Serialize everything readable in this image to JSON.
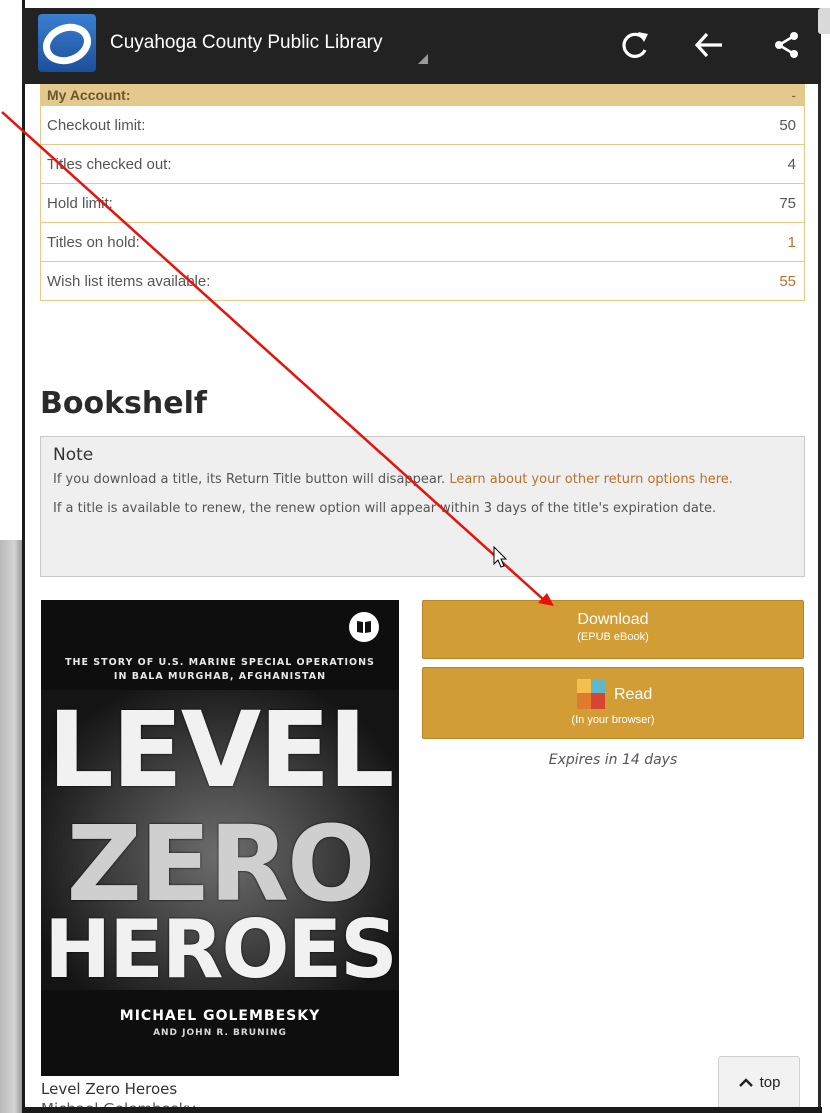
{
  "app": {
    "title": "Cuyahoga County Public Library"
  },
  "account": {
    "header": "My Account:",
    "header_value": "-",
    "rows": [
      {
        "label": "Checkout limit:",
        "value": "50",
        "link": false
      },
      {
        "label": "Titles checked out:",
        "value": "4",
        "link": false
      },
      {
        "label": "Hold limit:",
        "value": "75",
        "link": false
      },
      {
        "label": "Titles on hold:",
        "value": "1",
        "link": true
      },
      {
        "label": "Wish list items available:",
        "value": "55",
        "link": true
      }
    ]
  },
  "bookshelf": {
    "heading": "Bookshelf",
    "note": {
      "title": "Note",
      "text1": "If you download a title, its Return Title button will disappear.",
      "link": "Learn about your other return options here.",
      "text2": "If a title is available to renew, the renew option will appear within 3 days of the title's expiration date."
    },
    "book": {
      "title": "Level Zero Heroes",
      "author_partial": "Michael Golembesky",
      "cover": {
        "subtitle_line1": "THE STORY OF U.S. MARINE SPECIAL OPERATIONS",
        "subtitle_line2": "IN BALA MURGHAB, AFGHANISTAN",
        "word1": "LEVEL",
        "word2": "ZERO",
        "word3": "HEROES",
        "author": "MICHAEL GOLEMBESKY",
        "coauthor": "AND JOHN R. BRUNING"
      }
    },
    "download_button": {
      "label": "Download",
      "sub": "(EPUB eBook)"
    },
    "read_button": {
      "label": "Read",
      "sub": "(In your browser)"
    },
    "expires": "Expires in 14 days"
  },
  "top_button": {
    "label": "top"
  },
  "colors": {
    "accent": "#d29d34",
    "link": "#b8722a",
    "account_header": "#e3c98b",
    "annotation_arrow": "#e8120c"
  },
  "icons": [
    "menu-icon",
    "library-logo-icon",
    "refresh-icon",
    "back-arrow-icon",
    "share-icon",
    "book-icon",
    "read-app-icon",
    "chevron-up-icon",
    "mouse-cursor-icon"
  ]
}
